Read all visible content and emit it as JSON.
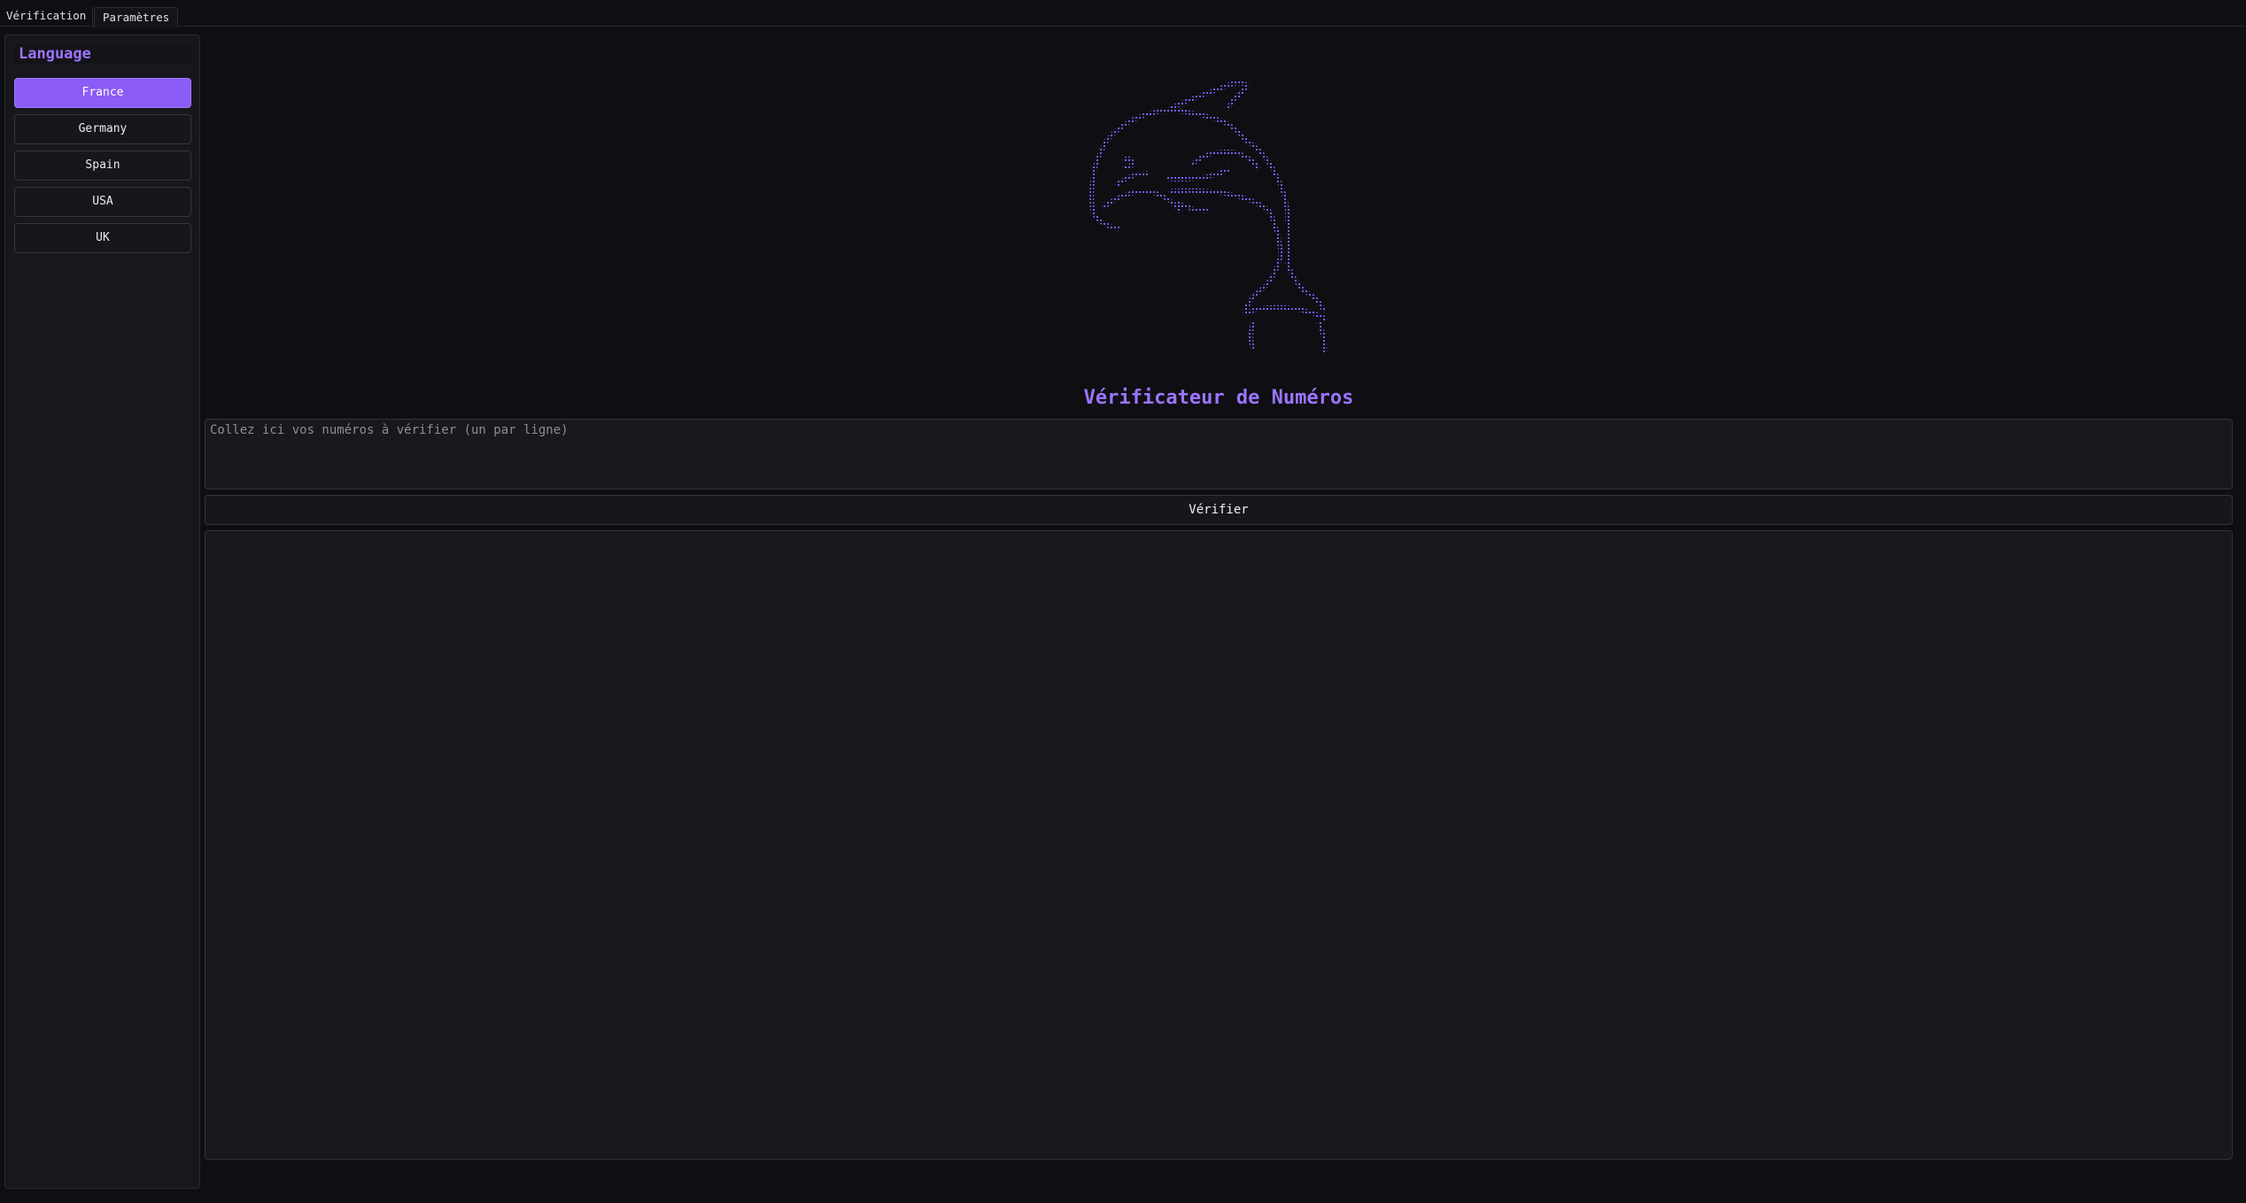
{
  "tabs": [
    {
      "label": "Vérification",
      "active": true
    },
    {
      "label": "Paramètres",
      "active": false
    }
  ],
  "sidebar": {
    "title": "Language",
    "items": [
      {
        "label": "France",
        "selected": true
      },
      {
        "label": "Germany",
        "selected": false
      },
      {
        "label": "Spain",
        "selected": false
      },
      {
        "label": "USA",
        "selected": false
      },
      {
        "label": "UK",
        "selected": false
      }
    ]
  },
  "main": {
    "logo_icon": "dolphin-ascii-art-icon",
    "title": "Vérificateur de Numéros",
    "input_placeholder": "Collez ici vos numéros à vérifier (un par ligne)",
    "verify_label": "Vérifier",
    "results_value": ""
  },
  "colors": {
    "accent": "#8b5cf6",
    "title": "#9d74ff",
    "background": "#0f0f13",
    "panel": "#17171c"
  }
}
